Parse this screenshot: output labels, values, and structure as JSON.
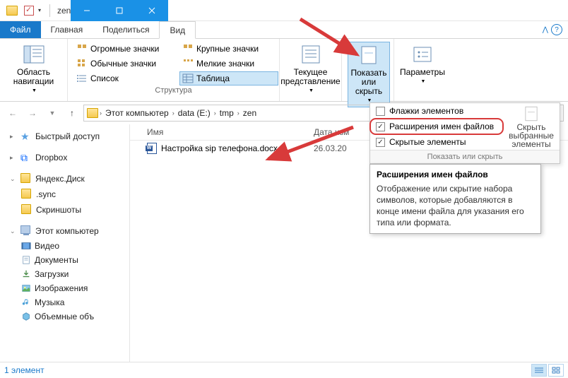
{
  "window": {
    "title": "zen"
  },
  "tabs": {
    "file": "Файл",
    "home": "Главная",
    "share": "Поделиться",
    "view": "Вид"
  },
  "ribbon": {
    "nav_pane": "Область навигации",
    "layout": {
      "huge": "Огромные значки",
      "large": "Крупные значки",
      "normal": "Обычные значки",
      "small": "Мелкие значки",
      "list": "Список",
      "table": "Таблица",
      "group": "Структура"
    },
    "current_view": {
      "label": "Текущее представление"
    },
    "show_hide": {
      "label": "Показать или скрыть"
    },
    "options": "Параметры"
  },
  "dropdown": {
    "flags": "Флажки элементов",
    "ext": "Расширения имен файлов",
    "hidden": "Скрытые элементы",
    "hide_selected": "Скрыть выбранные элементы",
    "footer": "Показать или скрыть"
  },
  "tooltip": {
    "title": "Расширения имен файлов",
    "body": "Отображение или скрытие набора символов, которые добавляются в конце имени файла для указания его типа или формата."
  },
  "breadcrumb": {
    "c0": "Этот компьютер",
    "c1": "data (E:)",
    "c2": "tmp",
    "c3": "zen"
  },
  "nav": {
    "quick": "Быстрый доступ",
    "dropbox": "Dropbox",
    "yandex": "Яндекс.Диск",
    "sync": ".sync",
    "screenshots": "Скриншоты",
    "pc": "Этот компьютер",
    "video": "Видео",
    "docs": "Документы",
    "downloads": "Загрузки",
    "images": "Изображения",
    "music": "Музыка",
    "volumes": "Объемные объ"
  },
  "columns": {
    "name": "Имя",
    "date": "Дата изм"
  },
  "files": [
    {
      "name": "Настройка sip телефона.docx",
      "date": "26.03.20"
    }
  ],
  "status": {
    "count": "1 элемент"
  }
}
